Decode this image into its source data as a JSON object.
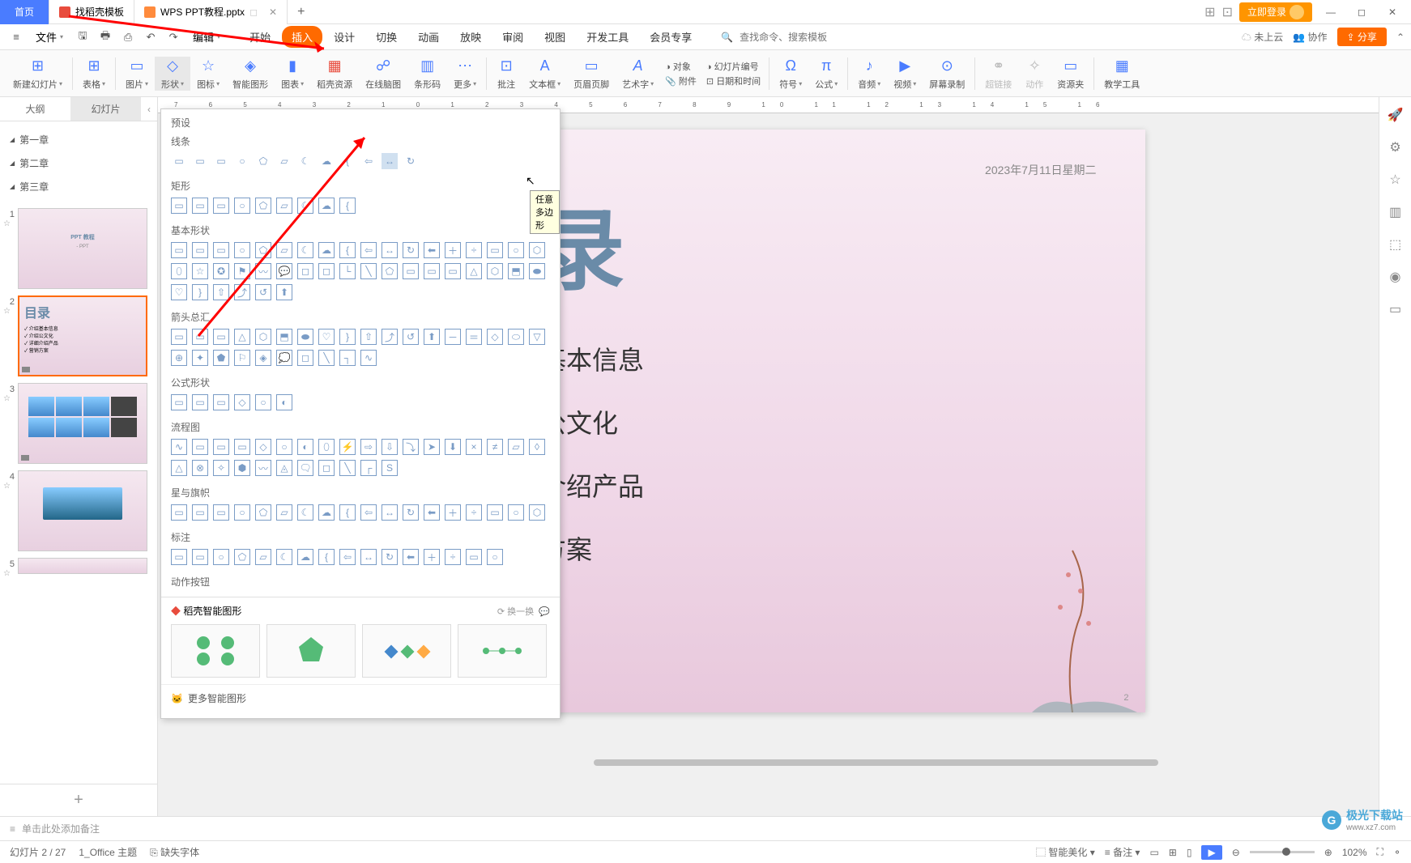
{
  "titlebar": {
    "home_tab": "首页",
    "tab1": "找稻壳模板",
    "tab2": "WPS PPT教程.pptx",
    "login": "立即登录"
  },
  "menubar": {
    "file": "文件",
    "edit": "编辑",
    "tabs": [
      "开始",
      "插入",
      "设计",
      "切换",
      "动画",
      "放映",
      "审阅",
      "视图",
      "开发工具",
      "会员专享"
    ],
    "active_tab_index": 1,
    "search_placeholder": "查找命令、搜索模板",
    "cloud": "未上云",
    "collab": "协作",
    "share": "分享"
  },
  "ribbon": {
    "items": [
      {
        "label": "新建幻灯片",
        "icon": "⊞"
      },
      {
        "label": "表格",
        "icon": "⊞"
      },
      {
        "label": "图片",
        "icon": "▭"
      },
      {
        "label": "形状",
        "icon": "◇",
        "highlighted": true
      },
      {
        "label": "图标",
        "icon": "☆"
      },
      {
        "label": "智能图形",
        "icon": "◈"
      },
      {
        "label": "图表",
        "icon": "▮"
      },
      {
        "label": "稻壳资源",
        "icon": "▦"
      },
      {
        "label": "在线脑图",
        "icon": "☍"
      },
      {
        "label": "条形码",
        "icon": "▥"
      },
      {
        "label": "更多",
        "icon": "⋯"
      },
      {
        "label": "批注",
        "icon": "⊡"
      },
      {
        "label": "文本框",
        "icon": "A"
      }
    ],
    "items2": [
      {
        "label": "页眉页脚",
        "icon": "▭"
      },
      {
        "label": "艺术字",
        "icon": "A"
      },
      {
        "label": "对象",
        "icon": "⬚",
        "prefix": "◑"
      },
      {
        "label": "附件",
        "icon": "📎",
        "prefix": "◇"
      },
      {
        "label": "幻灯片编号",
        "icon": "#",
        "prefix": "◑"
      },
      {
        "label": "日期和时间",
        "icon": "◷",
        "prefix": "⊡"
      }
    ],
    "items3": [
      {
        "label": "符号",
        "icon": "Ω"
      },
      {
        "label": "公式",
        "icon": "π"
      },
      {
        "label": "音频",
        "icon": "♪"
      },
      {
        "label": "视频",
        "icon": "▶"
      },
      {
        "label": "屏幕录制",
        "icon": "⊙"
      },
      {
        "label": "超链接",
        "icon": "⚭"
      },
      {
        "label": "动作",
        "icon": "✧"
      },
      {
        "label": "资源夹",
        "icon": "▭"
      },
      {
        "label": "教学工具",
        "icon": "▦"
      }
    ]
  },
  "outline": {
    "tab_outline": "大纲",
    "tab_slides": "幻灯片",
    "chapters": [
      "第一章",
      "第二章",
      "第三章"
    ]
  },
  "thumbnails": {
    "slide1_title": "PPT 教程",
    "slide1_sub": "- PPT",
    "slide2_title": "目录",
    "slide2_items": [
      "介绍基本信息",
      "介绍公文化",
      "详细介绍产品",
      "营销方案"
    ]
  },
  "shapes_panel": {
    "preset": "预设",
    "sections": {
      "lines": "线条",
      "rects": "矩形",
      "basic": "基本形状",
      "arrows": "箭头总汇",
      "formula": "公式形状",
      "flowchart": "流程图",
      "stars": "星与旗帜",
      "callouts": "标注",
      "actions": "动作按钮"
    },
    "tooltip": "任意多边形",
    "smart_title": "稻壳智能图形",
    "refresh": "换一换",
    "more": "更多智能图形"
  },
  "slide": {
    "date": "2023年7月11日星期二",
    "title": "目录",
    "items": [
      "介绍基本信息",
      "介绍公文化",
      "详细介绍产品",
      "营销方案"
    ]
  },
  "notes": {
    "placeholder": "单击此处添加备注"
  },
  "statusbar": {
    "slide_info": "幻灯片 2 / 27",
    "theme": "1_Office 主题",
    "missing_font": "缺失字体",
    "smart_beautify": "智能美化",
    "notes_btn": "备注",
    "zoom": "102%"
  },
  "watermark": {
    "text": "极光下载站",
    "url": "www.xz7.com"
  }
}
